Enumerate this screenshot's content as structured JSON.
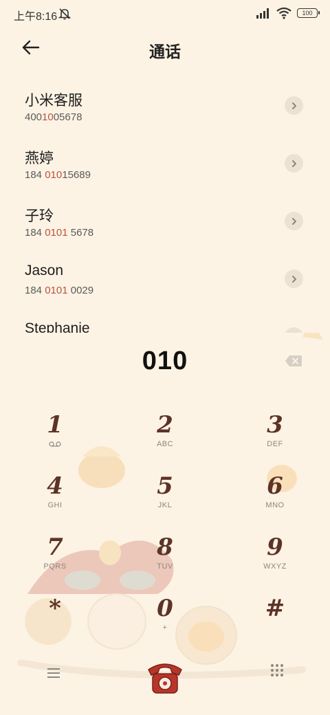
{
  "status_bar": {
    "time": "上午8:16",
    "battery": "100"
  },
  "header": {
    "title": "通话"
  },
  "contacts": [
    {
      "name": "小米客服",
      "number_pre": "400",
      "number_match": "10",
      "number_post": "05678"
    },
    {
      "name": "燕婷",
      "number_pre": "184 ",
      "number_match": "010",
      "number_post": "15689"
    },
    {
      "name": "子玲",
      "number_pre": "184 ",
      "number_match": "0101",
      "number_post": " 5678"
    },
    {
      "name": "Jason",
      "number_pre": "184 ",
      "number_match": "0101",
      "number_post": " 0029"
    },
    {
      "name": "Stephanie",
      "number_pre": "",
      "number_match": "",
      "number_post": ""
    }
  ],
  "dialer": {
    "input": "010",
    "keys": [
      {
        "digit": "1",
        "letters": ""
      },
      {
        "digit": "2",
        "letters": "ABC"
      },
      {
        "digit": "3",
        "letters": "DEF"
      },
      {
        "digit": "4",
        "letters": "GHI"
      },
      {
        "digit": "5",
        "letters": "JKL"
      },
      {
        "digit": "6",
        "letters": "MNO"
      },
      {
        "digit": "7",
        "letters": "PQRS"
      },
      {
        "digit": "8",
        "letters": "TUV"
      },
      {
        "digit": "9",
        "letters": "WXYZ"
      },
      {
        "digit": "*",
        "letters": ""
      },
      {
        "digit": "0",
        "letters": "+"
      },
      {
        "digit": "#",
        "letters": ""
      }
    ]
  },
  "icons": {
    "back": "arrow-left-icon",
    "mute": "bell-off-icon",
    "detail": "chevron-right-icon",
    "backspace": "backspace-icon",
    "voicemail": "voicemail-icon",
    "menu": "menu-icon",
    "call": "phone-icon",
    "keypad": "dialpad-icon"
  },
  "colors": {
    "background": "#fdf3e4",
    "digit": "#5c3328",
    "match": "#b8533e",
    "call": "#b8352a"
  }
}
